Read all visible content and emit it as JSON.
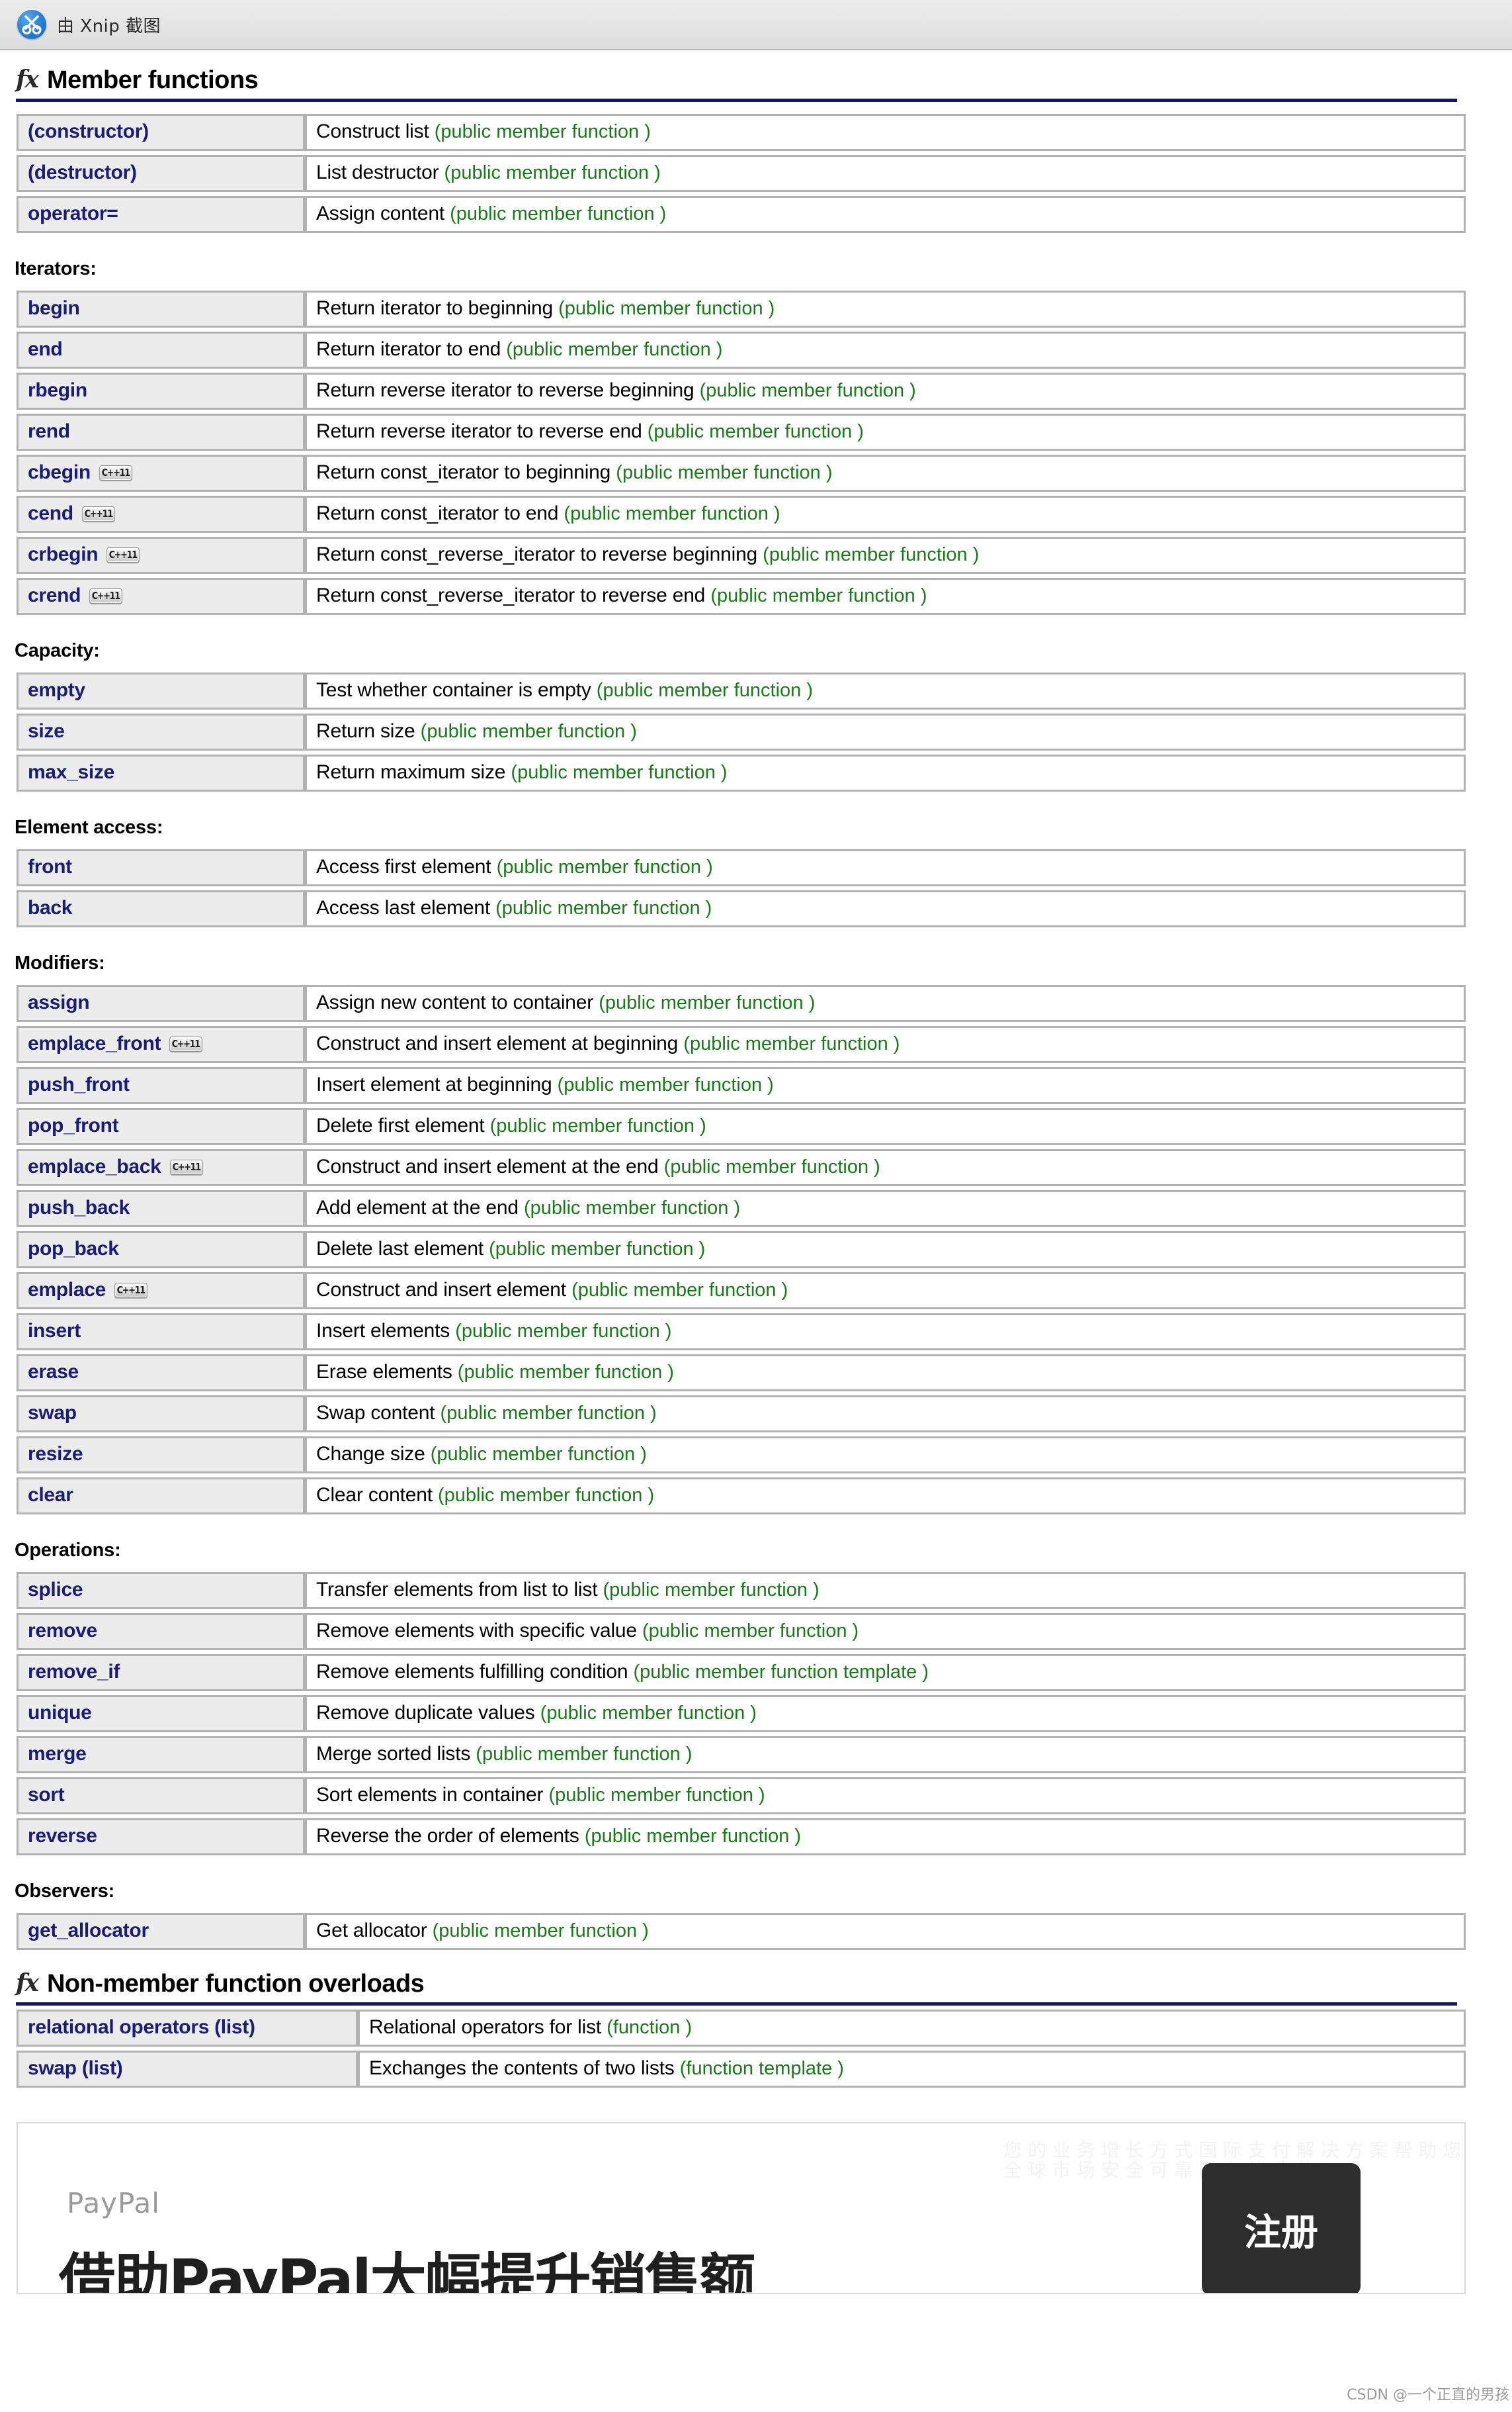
{
  "titlebar": {
    "icon": "xnip-scissors-icon",
    "label": "由 Xnip 截图"
  },
  "sections": [
    {
      "id": "member-functions",
      "icon": "fx-icon",
      "title": "Member functions",
      "groups": [
        {
          "label": "",
          "rows": [
            {
              "name": "(constructor)",
              "cpp11": false,
              "desc": "Construct list ",
              "kind": "(public member function )"
            },
            {
              "name": "(destructor)",
              "cpp11": false,
              "desc": "List destructor ",
              "kind": "(public member function )"
            },
            {
              "name": "operator=",
              "cpp11": false,
              "desc": "Assign content ",
              "kind": "(public member function )"
            }
          ]
        },
        {
          "label": "Iterators:",
          "rows": [
            {
              "name": "begin",
              "cpp11": false,
              "desc": "Return iterator to beginning ",
              "kind": "(public member function )"
            },
            {
              "name": "end",
              "cpp11": false,
              "desc": "Return iterator to end ",
              "kind": "(public member function )"
            },
            {
              "name": "rbegin",
              "cpp11": false,
              "desc": "Return reverse iterator to reverse beginning ",
              "kind": "(public member function )"
            },
            {
              "name": "rend",
              "cpp11": false,
              "desc": "Return reverse iterator to reverse end ",
              "kind": "(public member function )"
            },
            {
              "name": "cbegin",
              "cpp11": true,
              "desc": "Return const_iterator to beginning ",
              "kind": "(public member function )"
            },
            {
              "name": "cend",
              "cpp11": true,
              "desc": "Return const_iterator to end ",
              "kind": "(public member function )"
            },
            {
              "name": "crbegin",
              "cpp11": true,
              "desc": "Return const_reverse_iterator to reverse beginning ",
              "kind": "(public member function )"
            },
            {
              "name": "crend",
              "cpp11": true,
              "desc": "Return const_reverse_iterator to reverse end ",
              "kind": "(public member function )"
            }
          ]
        },
        {
          "label": "Capacity:",
          "rows": [
            {
              "name": "empty",
              "cpp11": false,
              "desc": "Test whether container is empty ",
              "kind": "(public member function )"
            },
            {
              "name": "size",
              "cpp11": false,
              "desc": "Return size ",
              "kind": "(public member function )"
            },
            {
              "name": "max_size",
              "cpp11": false,
              "desc": "Return maximum size ",
              "kind": "(public member function )"
            }
          ]
        },
        {
          "label": "Element access:",
          "rows": [
            {
              "name": "front",
              "cpp11": false,
              "desc": "Access first element ",
              "kind": "(public member function )"
            },
            {
              "name": "back",
              "cpp11": false,
              "desc": "Access last element ",
              "kind": "(public member function )"
            }
          ]
        },
        {
          "label": "Modifiers:",
          "rows": [
            {
              "name": "assign",
              "cpp11": false,
              "desc": "Assign new content to container ",
              "kind": "(public member function )"
            },
            {
              "name": "emplace_front",
              "cpp11": true,
              "desc": "Construct and insert element at beginning ",
              "kind": "(public member function )"
            },
            {
              "name": "push_front",
              "cpp11": false,
              "desc": "Insert element at beginning ",
              "kind": "(public member function )"
            },
            {
              "name": "pop_front",
              "cpp11": false,
              "desc": "Delete first element ",
              "kind": "(public member function )"
            },
            {
              "name": "emplace_back",
              "cpp11": true,
              "desc": "Construct and insert element at the end ",
              "kind": "(public member function )"
            },
            {
              "name": "push_back",
              "cpp11": false,
              "desc": "Add element at the end ",
              "kind": "(public member function )"
            },
            {
              "name": "pop_back",
              "cpp11": false,
              "desc": "Delete last element ",
              "kind": "(public member function )"
            },
            {
              "name": "emplace",
              "cpp11": true,
              "desc": "Construct and insert element ",
              "kind": "(public member function )"
            },
            {
              "name": "insert",
              "cpp11": false,
              "desc": "Insert elements ",
              "kind": "(public member function )"
            },
            {
              "name": "erase",
              "cpp11": false,
              "desc": "Erase elements ",
              "kind": "(public member function )"
            },
            {
              "name": "swap",
              "cpp11": false,
              "desc": "Swap content ",
              "kind": "(public member function )"
            },
            {
              "name": "resize",
              "cpp11": false,
              "desc": "Change size ",
              "kind": "(public member function )"
            },
            {
              "name": "clear",
              "cpp11": false,
              "desc": "Clear content ",
              "kind": "(public member function )"
            }
          ]
        },
        {
          "label": "Operations:",
          "rows": [
            {
              "name": "splice",
              "cpp11": false,
              "desc": "Transfer elements from list to list ",
              "kind": "(public member function )"
            },
            {
              "name": "remove",
              "cpp11": false,
              "desc": "Remove elements with specific value ",
              "kind": "(public member function )"
            },
            {
              "name": "remove_if",
              "cpp11": false,
              "desc": "Remove elements fulfilling condition ",
              "kind": "(public member function template )"
            },
            {
              "name": "unique",
              "cpp11": false,
              "desc": "Remove duplicate values ",
              "kind": "(public member function )"
            },
            {
              "name": "merge",
              "cpp11": false,
              "desc": "Merge sorted lists ",
              "kind": "(public member function )"
            },
            {
              "name": "sort",
              "cpp11": false,
              "desc": "Sort elements in container ",
              "kind": "(public member function )"
            },
            {
              "name": "reverse",
              "cpp11": false,
              "desc": "Reverse the order of elements ",
              "kind": "(public member function )"
            }
          ]
        },
        {
          "label": "Observers:",
          "rows": [
            {
              "name": "get_allocator",
              "cpp11": false,
              "desc": "Get allocator ",
              "kind": "(public member function )"
            }
          ]
        }
      ]
    },
    {
      "id": "non-member-function-overloads",
      "icon": "fx-icon",
      "title": "Non-member function overloads",
      "groups": [
        {
          "label": "",
          "rows": [
            {
              "name": "relational operators (list)",
              "cpp11": false,
              "wide": true,
              "desc": "Relational operators for list ",
              "kind": "(function )"
            },
            {
              "name": "swap (list)",
              "cpp11": false,
              "desc": "Exchanges the contents of two lists ",
              "kind": "(function template )"
            }
          ]
        }
      ]
    }
  ],
  "badge": {
    "cpp11_label": "C++11"
  },
  "ad": {
    "brand": "PayPal",
    "headline": "借助PayPal大幅提升销售额",
    "cta": "注册",
    "ghost": "您 的 业 务 增 长 方 式 国 际 支 付 解 决 方 案 帮 助 您 拓 展 全 球 市 场 安 全 可 靠 的 在 线 收 款"
  },
  "watermark": "CSDN @一个正直的男孩",
  "colors": {
    "link_blue": "#1b1b7a",
    "kind_green": "#1a7a1a",
    "rule_navy": "#14146e",
    "cell_gray": "#ececec",
    "border_gray": "#b2b2b2"
  }
}
